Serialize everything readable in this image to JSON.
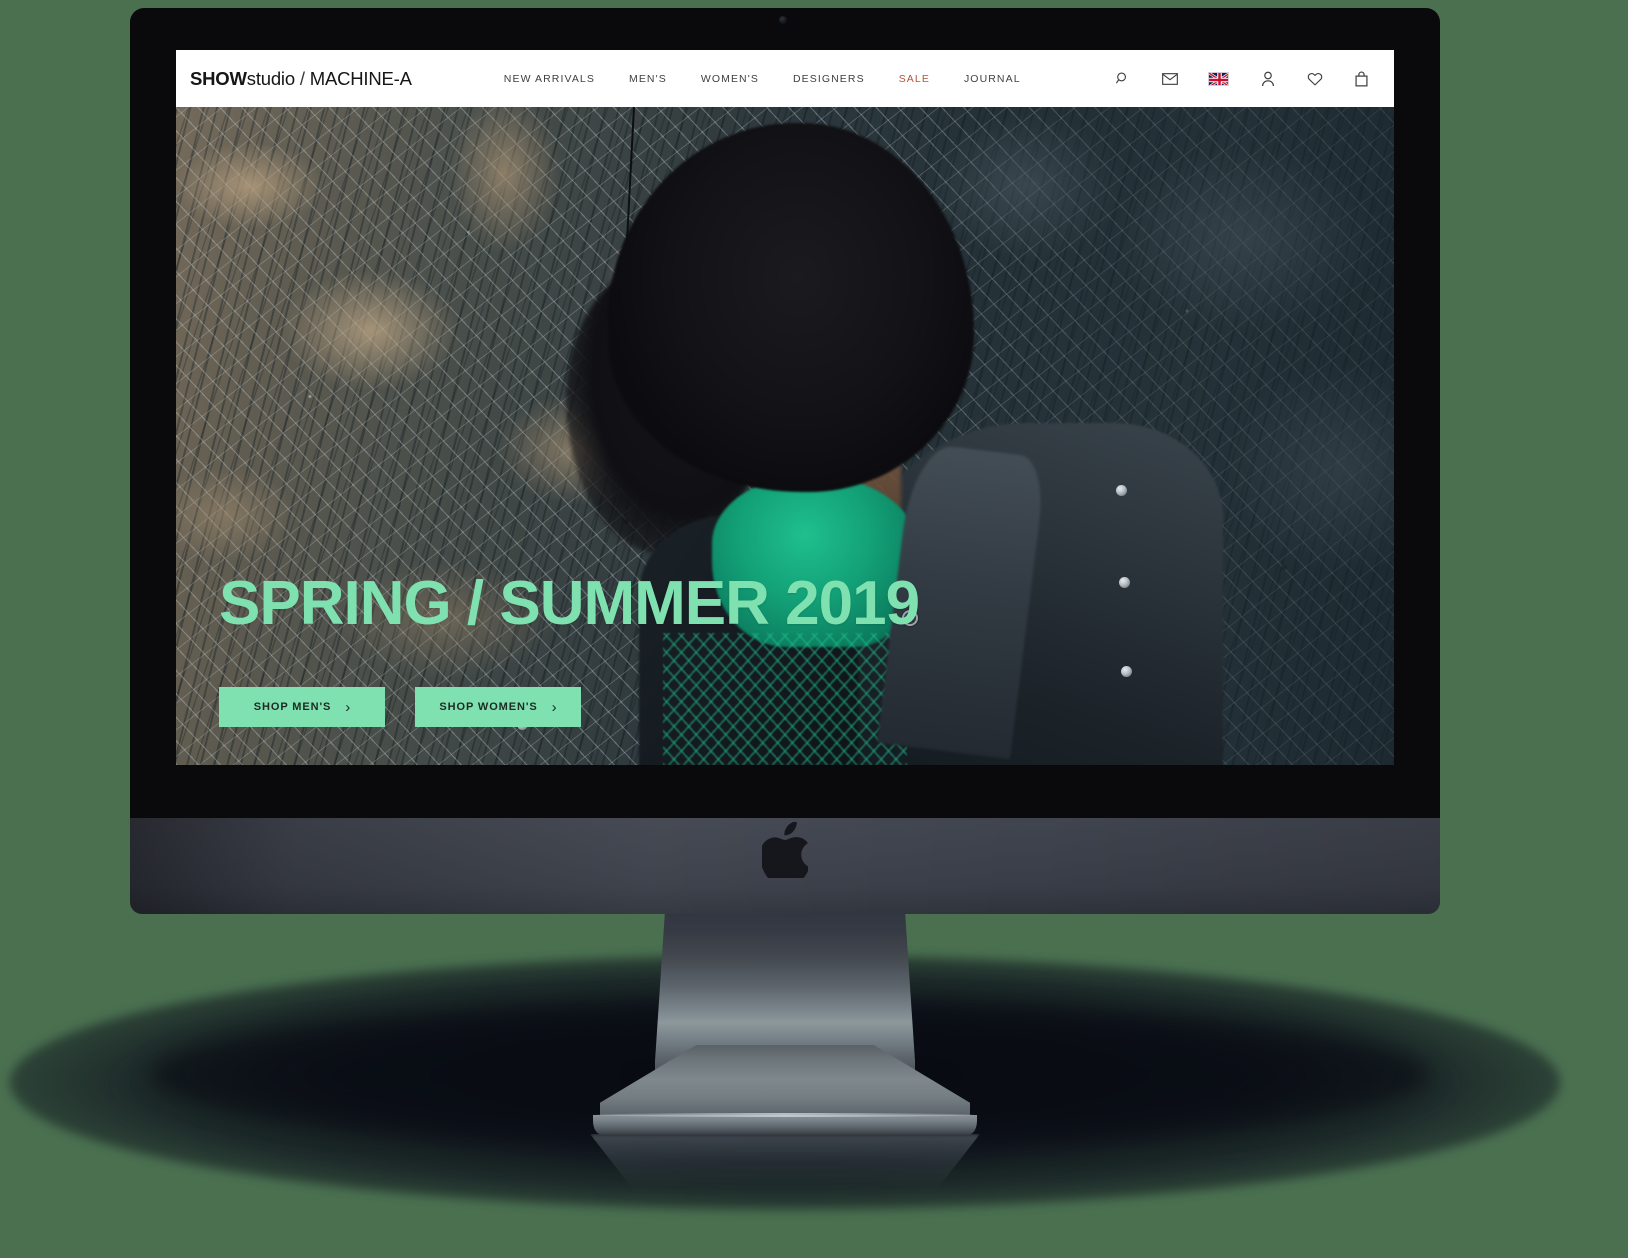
{
  "site": {
    "brand": {
      "bold": "SHOW",
      "light": "studio",
      "separator": " / ",
      "partner": "MACHINE-A",
      "full": "SHOWstudio / MACHINE-A"
    },
    "nav": [
      {
        "label": "NEW ARRIVALS",
        "name": "nav-new-arrivals",
        "highlight": false
      },
      {
        "label": "MEN'S",
        "name": "nav-mens",
        "highlight": false
      },
      {
        "label": "WOMEN'S",
        "name": "nav-womens",
        "highlight": false
      },
      {
        "label": "DESIGNERS",
        "name": "nav-designers",
        "highlight": false
      },
      {
        "label": "SALE",
        "name": "nav-sale",
        "highlight": true
      },
      {
        "label": "JOURNAL",
        "name": "nav-journal",
        "highlight": false
      }
    ],
    "icons": [
      {
        "name": "search-icon",
        "glyph": "search"
      },
      {
        "name": "mail-icon",
        "glyph": "envelope"
      },
      {
        "name": "language-flag-icon",
        "glyph": "uk-flag"
      },
      {
        "name": "account-icon",
        "glyph": "person"
      },
      {
        "name": "wishlist-icon",
        "glyph": "heart"
      },
      {
        "name": "bag-icon",
        "glyph": "shopping-bag"
      }
    ],
    "hero": {
      "headline": "SPRING / SUMMER 2019",
      "buttons": [
        {
          "label": "SHOP MEN'S",
          "chevron": "›"
        },
        {
          "label": "SHOP WOMEN'S",
          "chevron": "›"
        }
      ],
      "image_description": "Model with dark hair in black coat and green turtleneck against a marble wall"
    }
  },
  "colors": {
    "page_background": "#4a7050",
    "accent_mint": "#7fe0b0",
    "sale_red": "#b4543a",
    "header_background": "#ffffff",
    "nav_text": "#3f3f3f",
    "bezel": "#0a0a0c",
    "chin": "#3d414b"
  },
  "device": {
    "type": "imac-pro",
    "logo": "apple-logo"
  }
}
